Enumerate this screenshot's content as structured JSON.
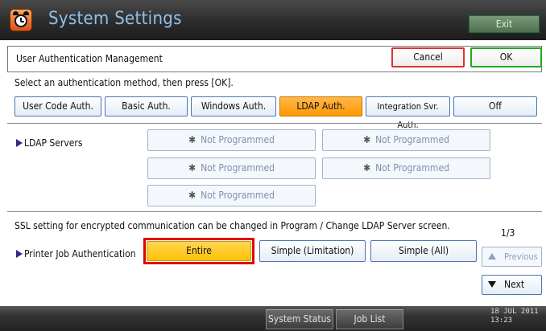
{
  "window": {
    "title": "System Settings",
    "exit_label": "Exit"
  },
  "header": {
    "title": "User Authentication Management",
    "cancel_label": "Cancel",
    "ok_label": "OK"
  },
  "instruction": "Select an authentication method, then press [OK].",
  "auth_methods": [
    {
      "label": "User Code Auth.",
      "selected": false
    },
    {
      "label": "Basic Auth.",
      "selected": false
    },
    {
      "label": "Windows Auth.",
      "selected": false
    },
    {
      "label": "LDAP Auth.",
      "selected": true
    },
    {
      "label": "Integration Svr. Auth.",
      "selected": false
    },
    {
      "label": "Off",
      "selected": false
    }
  ],
  "ldap_servers": {
    "label": "LDAP Servers",
    "slots": [
      "Not Programmed",
      "Not Programmed",
      "Not Programmed",
      "Not Programmed",
      "Not Programmed"
    ],
    "slot_icon": "asterisk-icon"
  },
  "ssl_note": "SSL setting for encrypted communication can be changed in Program / Change LDAP Server screen.",
  "printer_job_auth": {
    "label": "Printer Job Authentication",
    "options": [
      {
        "label": "Entire",
        "selected": true
      },
      {
        "label": "Simple (Limitation)",
        "selected": false
      },
      {
        "label": "Simple (All)",
        "selected": false
      }
    ]
  },
  "pagination": {
    "indicator": "1/3",
    "previous_label": "Previous",
    "next_label": "Next"
  },
  "statusbar": {
    "system_status_label": "System Status",
    "job_list_label": "Job List",
    "date": "18 JUL  2011",
    "time": "13:23"
  },
  "colors": {
    "selected_orange": "#ff9900",
    "selected_yellow": "#ffc107",
    "highlight_red": "#e00000",
    "ok_green": "#22aa22",
    "cancel_red": "#dd3333",
    "title_blue": "#8fc0ea"
  }
}
